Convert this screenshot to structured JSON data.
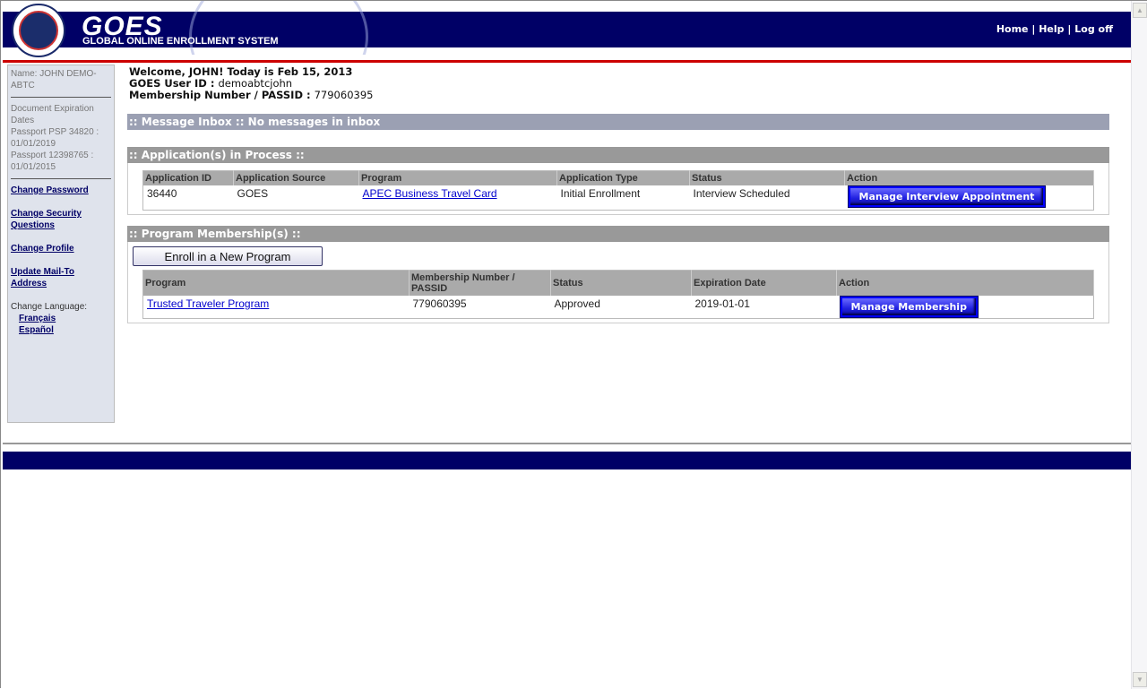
{
  "header": {
    "logo_text": "GOES",
    "logo_subtitle": "GLOBAL ONLINE ENROLLMENT SYSTEM",
    "seal_text": "U.S. DEPARTMENT OF HOMELAND SECURITY",
    "nav": {
      "home": "Home",
      "help": "Help",
      "logoff": "Log off",
      "sep": "|"
    }
  },
  "sidebar": {
    "name": "Name: JOHN DEMO-ABTC",
    "doc_title": "Document Expiration Dates",
    "docs": [
      "Passport PSP 34820 : 01/01/2019",
      "Passport 12398765 : 01/01/2015"
    ],
    "links": [
      "Change Password",
      "Change Security Questions",
      "Change Profile",
      "Update Mail-To Address"
    ],
    "lang_label": "Change Language:",
    "languages": [
      "Français",
      "Español"
    ]
  },
  "welcome": {
    "line1": "Welcome, JOHN! Today is Feb 15, 2013",
    "userid_label": "GOES User ID :",
    "userid": "demoabtcjohn",
    "passid_label": "Membership Number / PASSID :",
    "passid": "779060395"
  },
  "inbox": {
    "title": ":: Message Inbox :: No messages in inbox"
  },
  "applications": {
    "title": ":: Application(s) in Process ::",
    "columns": [
      "Application ID",
      "Application Source",
      "Program",
      "Application Type",
      "Status",
      "Action"
    ],
    "rows": [
      {
        "id": "36440",
        "source": "GOES",
        "program": "APEC Business Travel Card",
        "type": "Initial Enrollment",
        "status": "Interview Scheduled",
        "action": "Manage Interview Appointment"
      }
    ]
  },
  "memberships": {
    "title": ":: Program Membership(s) ::",
    "enroll_button": "Enroll in a New Program",
    "columns": [
      "Program",
      "Membership Number / PASSID",
      "Status",
      "Expiration Date",
      "Action"
    ],
    "rows": [
      {
        "program": "Trusted Traveler Program",
        "number": "779060395",
        "status": "Approved",
        "expiration": "2019-01-01",
        "action": "Manage Membership"
      }
    ]
  },
  "colors": {
    "navy": "#000066",
    "red": "#cc0000",
    "button_blue": "#2020e0"
  }
}
